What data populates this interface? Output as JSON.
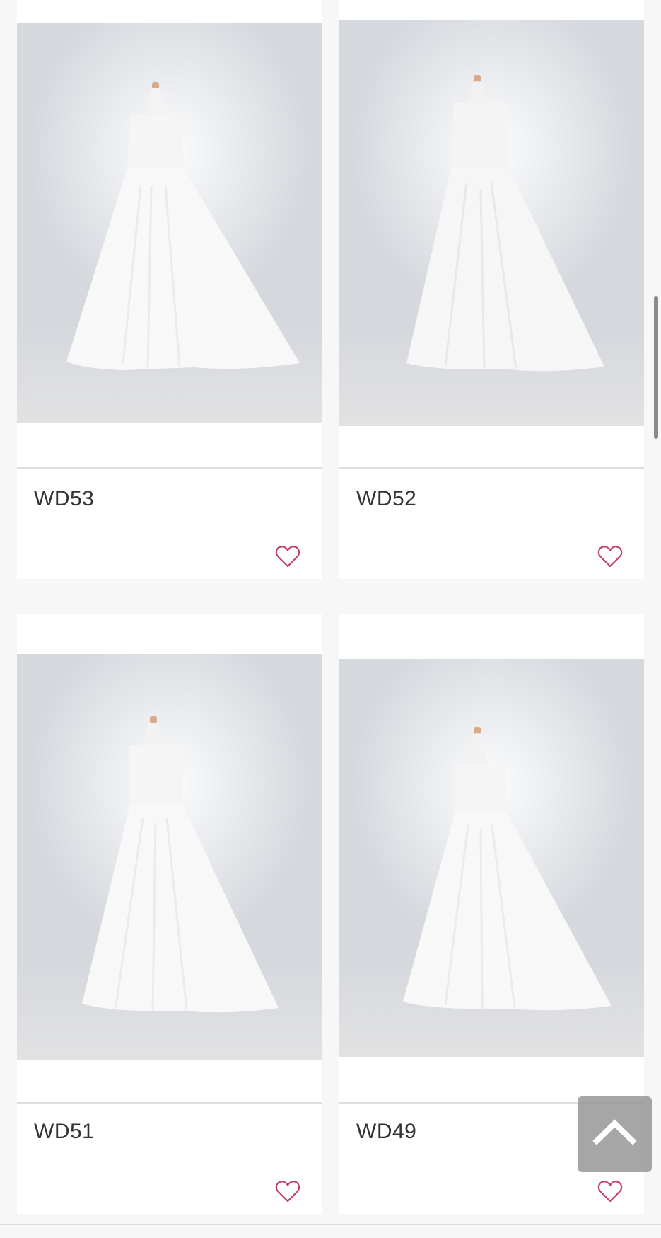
{
  "products": [
    {
      "code": "WD53"
    },
    {
      "code": "WD52"
    },
    {
      "code": "WD51"
    },
    {
      "code": "WD49"
    }
  ],
  "icons": {
    "favorite": "heart-outline-icon",
    "scroll_top": "chevron-up-icon"
  },
  "colors": {
    "heart": "#c2416a",
    "background": "#f7f7f7",
    "card": "#ffffff",
    "text": "#333333"
  }
}
